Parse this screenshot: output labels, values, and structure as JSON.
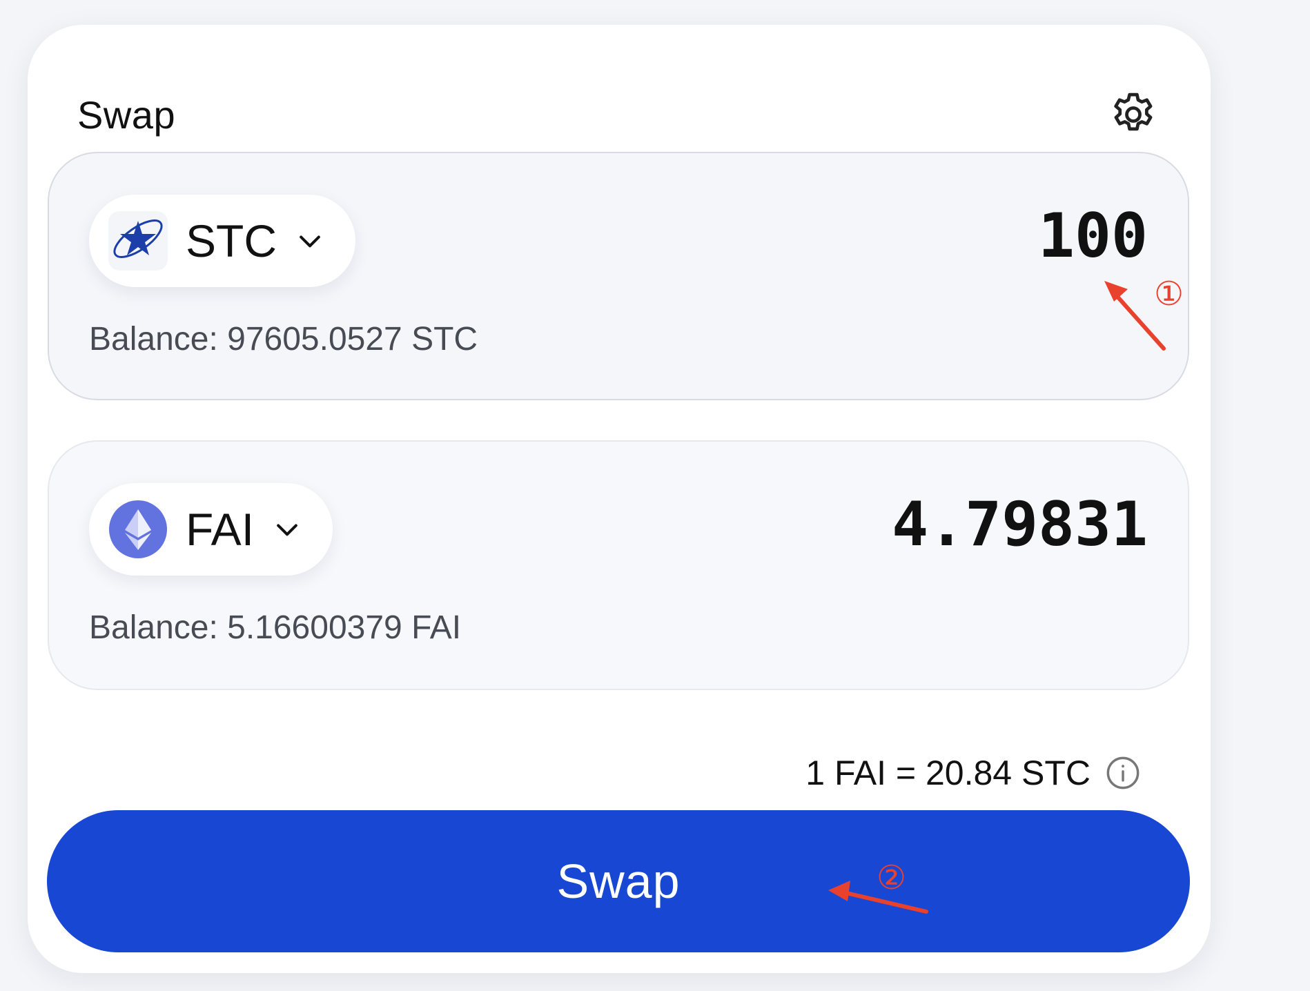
{
  "header": {
    "title": "Swap",
    "settings_icon": "gear-icon"
  },
  "from": {
    "token_symbol": "STC",
    "token_icon": "starcoin-logo",
    "amount": "100",
    "balance": "Balance: 97605.0527 STC"
  },
  "to": {
    "token_symbol": "FAI",
    "token_icon": "ethereum-logo",
    "amount": "4.79831",
    "balance": "Balance: 5.16600379 FAI"
  },
  "switch_icon": "arrow-down-icon",
  "rate": {
    "text": "1 FAI = 20.84 STC",
    "icon": "info-icon"
  },
  "swap_button": {
    "label": "Swap"
  },
  "annotations": [
    {
      "label": "①",
      "color": "#e8412e"
    },
    {
      "label": "②",
      "color": "#e8412e"
    }
  ],
  "colors": {
    "accent": "#1847d4",
    "annotation": "#e8412e",
    "card_bg": "#ffffff",
    "panel_bg": "#f7f8fb"
  }
}
